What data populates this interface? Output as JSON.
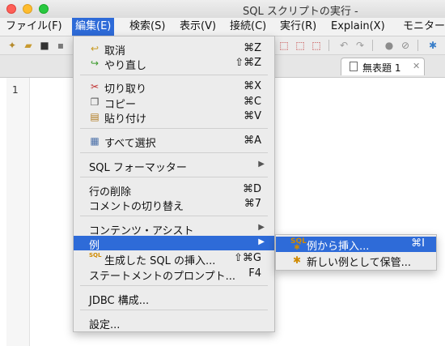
{
  "window": {
    "title": "SQL スクリプトの実行 -"
  },
  "menubar": [
    {
      "label": "ファイル(F)"
    },
    {
      "label": "編集(E)"
    },
    {
      "label": "検索(S)"
    },
    {
      "label": "表示(V)"
    },
    {
      "label": "接続(C)"
    },
    {
      "label": "実行(R)"
    },
    {
      "label": "Explain(X)"
    },
    {
      "label": "モニター"
    }
  ],
  "tab": {
    "label": "無表題 1",
    "close": "✕"
  },
  "editor": {
    "line_number": "1"
  },
  "edit_menu": {
    "undo": {
      "label": "取消",
      "shortcut": "⌘Z"
    },
    "redo": {
      "label": "やり直し",
      "shortcut": "⇧⌘Z"
    },
    "cut": {
      "label": "切り取り",
      "shortcut": "⌘X"
    },
    "copy": {
      "label": "コピー",
      "shortcut": "⌘C"
    },
    "paste": {
      "label": "貼り付け",
      "shortcut": "⌘V"
    },
    "select_all": {
      "label": "すべて選択",
      "shortcut": "⌘A"
    },
    "sql_formatter": {
      "label": "SQL フォーマッター"
    },
    "delete_line": {
      "label": "行の削除",
      "shortcut": "⌘D"
    },
    "toggle_comment": {
      "label": "コメントの切り替え",
      "shortcut": "⌘7"
    },
    "content_assist": {
      "label": "コンテンツ・アシスト"
    },
    "example": {
      "label": "例"
    },
    "insert_generated_sql": {
      "label": "生成した SQL の挿入...",
      "shortcut": "⇧⌘G"
    },
    "statement_prompt": {
      "label": "ステートメントのプロンプト...",
      "shortcut": "F4"
    },
    "jdbc_config": {
      "label": "JDBC 構成..."
    },
    "settings": {
      "label": "設定..."
    }
  },
  "example_submenu": {
    "insert_from_example": {
      "label": "例から挿入...",
      "shortcut": "⌘I"
    },
    "save_as_new_example": {
      "label": "新しい例として保管..."
    }
  },
  "icons": {
    "sql_badge": "SQL",
    "submenu_arrow": "▶"
  },
  "colors": {
    "highlight": "#2e6bd8",
    "menu_bg": "#ececec"
  }
}
